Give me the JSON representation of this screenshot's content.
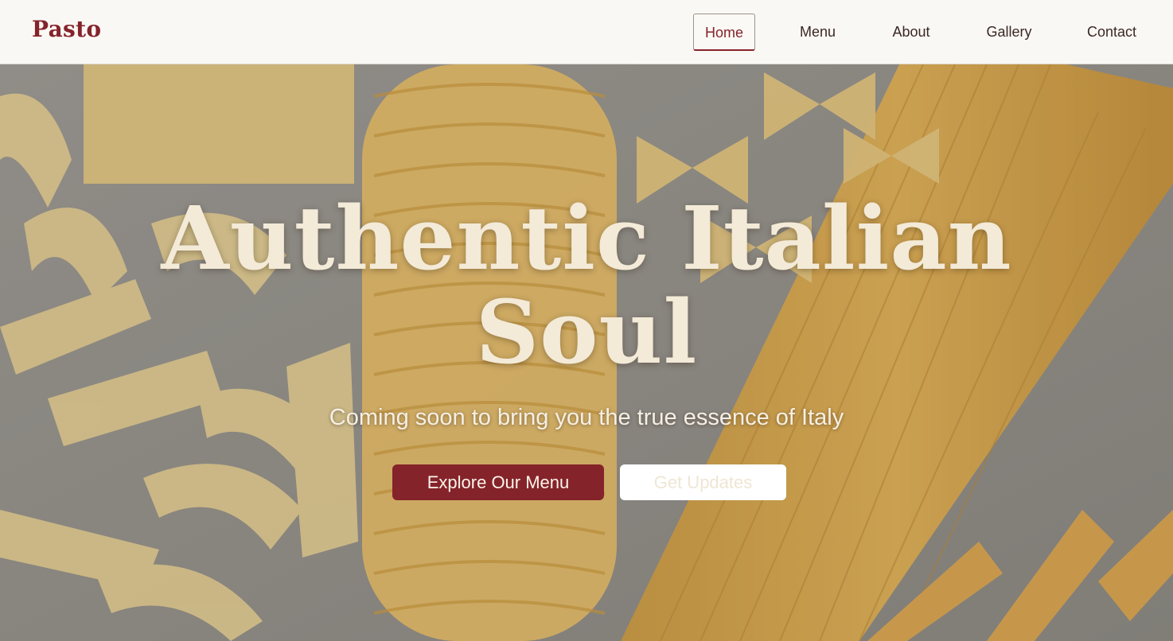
{
  "brand": "Pasto",
  "nav": {
    "items": [
      {
        "label": "Home",
        "active": true
      },
      {
        "label": "Menu",
        "active": false
      },
      {
        "label": "About",
        "active": false
      },
      {
        "label": "Gallery",
        "active": false
      },
      {
        "label": "Contact",
        "active": false
      }
    ]
  },
  "hero": {
    "title_line1": "Authentic Italian",
    "title_line2": "Soul",
    "subtitle": "Coming soon to bring you the true essence of Italy",
    "primary_button": "Explore Our Menu",
    "secondary_button": "Get Updates",
    "background_image": "pasta-variety-photo"
  },
  "colors": {
    "accent": "#85232a",
    "header_bg": "#faf8f5",
    "hero_text": "#f3ead8"
  }
}
